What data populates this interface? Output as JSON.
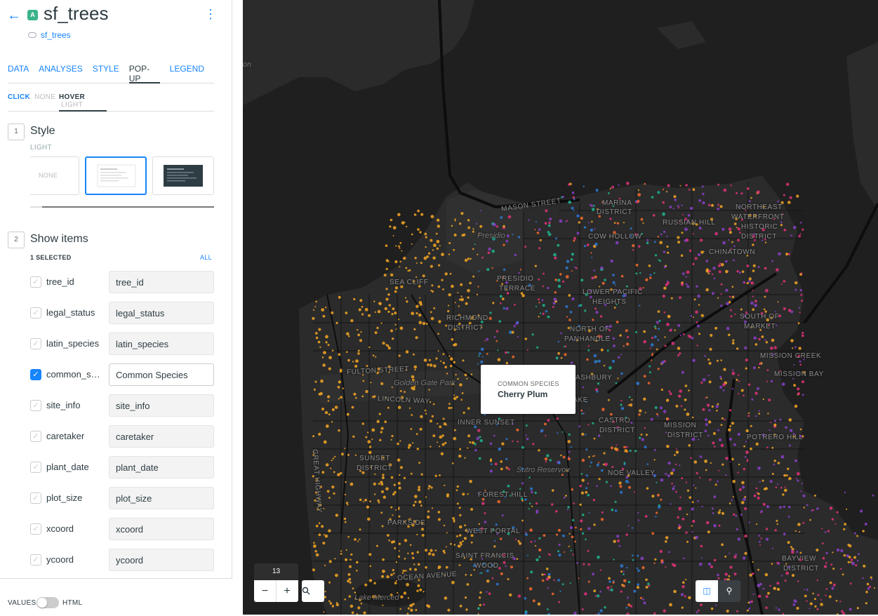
{
  "layer": {
    "badge": "A",
    "title": "sf_trees",
    "source": "sf_trees"
  },
  "tabs": [
    {
      "label": "DATA",
      "active": false
    },
    {
      "label": "ANALYSES",
      "active": false
    },
    {
      "label": "STYLE",
      "active": false
    },
    {
      "label": "POP-UP",
      "active": true
    },
    {
      "label": "LEGEND",
      "active": false
    }
  ],
  "subtabs": {
    "click_key": "CLICK",
    "click_val": "NONE",
    "hover_key": "HOVER",
    "hover_val": "LIGHT"
  },
  "style_section": {
    "number": "1",
    "title": "Style",
    "current": "LIGHT",
    "options": [
      {
        "label": "NONE",
        "selected": false
      },
      {
        "label": "",
        "selected": true
      },
      {
        "label": "",
        "selected": false
      }
    ]
  },
  "items_section": {
    "number": "2",
    "title": "Show items",
    "selected_count": "1 SELECTED",
    "all_label": "ALL",
    "items": [
      {
        "label": "tree_id",
        "value": "tree_id",
        "checked": false
      },
      {
        "label": "legal_status",
        "value": "legal_status",
        "checked": false
      },
      {
        "label": "latin_species",
        "value": "latin_species",
        "checked": false
      },
      {
        "label": "common_species",
        "value": "Common Species",
        "checked": true
      },
      {
        "label": "site_info",
        "value": "site_info",
        "checked": false
      },
      {
        "label": "caretaker",
        "value": "caretaker",
        "checked": false
      },
      {
        "label": "plant_date",
        "value": "plant_date",
        "checked": false
      },
      {
        "label": "plot_size",
        "value": "plot_size",
        "checked": false
      },
      {
        "label": "xcoord",
        "value": "xcoord",
        "checked": false
      },
      {
        "label": "ycoord",
        "value": "ycoord",
        "checked": false
      }
    ]
  },
  "footer": {
    "values_label": "VALUES",
    "html_label": "HTML",
    "toggle_on": false
  },
  "map": {
    "zoom": "13",
    "popup": {
      "heading": "COMMON SPECIES",
      "value": "Cherry Plum"
    },
    "labels": [
      {
        "text": "MASON STREET",
        "kind": "street"
      },
      {
        "text": "MARINA",
        "kind": "district"
      },
      {
        "text": "DISTRICT",
        "kind": "district"
      },
      {
        "text": "NORTHEAST",
        "kind": "district"
      },
      {
        "text": "WATERFRONT",
        "kind": "district"
      },
      {
        "text": "HISTORIC",
        "kind": "district"
      },
      {
        "text": "DISTRICT",
        "kind": "district"
      },
      {
        "text": "RUSSIAN HILL",
        "kind": "district"
      },
      {
        "text": "COW HOLLOW",
        "kind": "district"
      },
      {
        "text": "Presidio",
        "kind": "park"
      },
      {
        "text": "CHINATOWN",
        "kind": "district"
      },
      {
        "text": "SEA CLIFF",
        "kind": "district"
      },
      {
        "text": "PRESIDIO",
        "kind": "district"
      },
      {
        "text": "TERRACE",
        "kind": "district"
      },
      {
        "text": "LOWER PACIFIC",
        "kind": "district"
      },
      {
        "text": "HEIGHTS",
        "kind": "district"
      },
      {
        "text": "RICHMOND",
        "kind": "district"
      },
      {
        "text": "DISTRICT",
        "kind": "district"
      },
      {
        "text": "NORTH OF",
        "kind": "district"
      },
      {
        "text": "PANHANDLE",
        "kind": "district"
      },
      {
        "text": "SOUTH OF",
        "kind": "district"
      },
      {
        "text": "MARKET",
        "kind": "district"
      },
      {
        "text": "FULTON STREET",
        "kind": "street"
      },
      {
        "text": "MISSION CREEK",
        "kind": "district"
      },
      {
        "text": "Golden Gate Park",
        "kind": "park"
      },
      {
        "text": "ASHBURY",
        "kind": "district"
      },
      {
        "text": "MISSION BAY",
        "kind": "district"
      },
      {
        "text": "LINCOLN WAY",
        "kind": "street"
      },
      {
        "text": "INNER SUNSET",
        "kind": "district"
      },
      {
        "text": "CASTRO",
        "kind": "district"
      },
      {
        "text": "DISTRICT",
        "kind": "district"
      },
      {
        "text": "MISSION",
        "kind": "district"
      },
      {
        "text": "DISTRICT",
        "kind": "district"
      },
      {
        "text": "POTRERO HILL",
        "kind": "district"
      },
      {
        "text": "SUNSET",
        "kind": "district"
      },
      {
        "text": "DISTRICT",
        "kind": "district"
      },
      {
        "text": "GREAT HIGHWAY",
        "kind": "street"
      },
      {
        "text": "Sutro Reservoir",
        "kind": "park"
      },
      {
        "text": "NOE VALLEY",
        "kind": "district"
      },
      {
        "text": "FOREST HILL",
        "kind": "district"
      },
      {
        "text": "PARKSIDE",
        "kind": "district"
      },
      {
        "text": "WEST PORTAL",
        "kind": "district"
      },
      {
        "text": "SAINT FRANCIS",
        "kind": "district"
      },
      {
        "text": "WOOD",
        "kind": "district"
      },
      {
        "text": "OCEAN AVENUE",
        "kind": "street"
      },
      {
        "text": "Lake Merced",
        "kind": "park"
      },
      {
        "text": "BAYVIEW",
        "kind": "district"
      },
      {
        "text": "DISTRICT",
        "kind": "district"
      },
      {
        "text": "LAKE",
        "kind": "district"
      },
      {
        "text": "on",
        "kind": "park"
      }
    ],
    "colors": {
      "land": "#2b2b2b",
      "water": "#1f1f1f",
      "road": "#121212",
      "park": "#303030",
      "points": [
        "#f5a623",
        "#e0327a",
        "#8a3fc9",
        "#1fb48f",
        "#2d7ad6",
        "#f36a2c"
      ]
    }
  }
}
